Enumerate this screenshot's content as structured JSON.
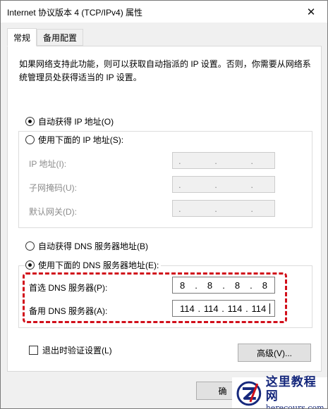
{
  "window": {
    "title": "Internet 协议版本 4 (TCP/IPv4) 属性",
    "close_glyph": "✕"
  },
  "tabs": [
    {
      "label": "常规",
      "active": true
    },
    {
      "label": "备用配置",
      "active": false
    }
  ],
  "description": "如果网络支持此功能，则可以获取自动指派的 IP 设置。否则，你需要从网络系统管理员处获得适当的 IP 设置。",
  "ip": {
    "auto_label": "自动获得 IP 地址(O)",
    "auto_selected": true,
    "manual_label": "使用下面的 IP 地址(S):",
    "manual_selected": false,
    "fields": [
      {
        "label": "IP 地址(I):",
        "value": ". . ."
      },
      {
        "label": "子网掩码(U):",
        "value": ". . ."
      },
      {
        "label": "默认网关(D):",
        "value": ". . ."
      }
    ]
  },
  "dns": {
    "auto_label": "自动获得 DNS 服务器地址(B)",
    "auto_selected": false,
    "manual_label": "使用下面的 DNS 服务器地址(E):",
    "manual_selected": true,
    "preferred": {
      "label": "首选 DNS 服务器(P):",
      "octets": [
        "8",
        "8",
        "8",
        "8"
      ]
    },
    "alternate": {
      "label": "备用 DNS 服务器(A):",
      "octets": [
        "114",
        "114",
        "114",
        "114"
      ]
    }
  },
  "validate_checkbox": {
    "label": "退出时验证设置(L)",
    "checked": false
  },
  "advanced_button": "高级(V)...",
  "ok_button_partial": "确",
  "highlight_color": "#d10f1a",
  "watermark": {
    "line1": "这里教程网",
    "line2": "herecours.com"
  }
}
